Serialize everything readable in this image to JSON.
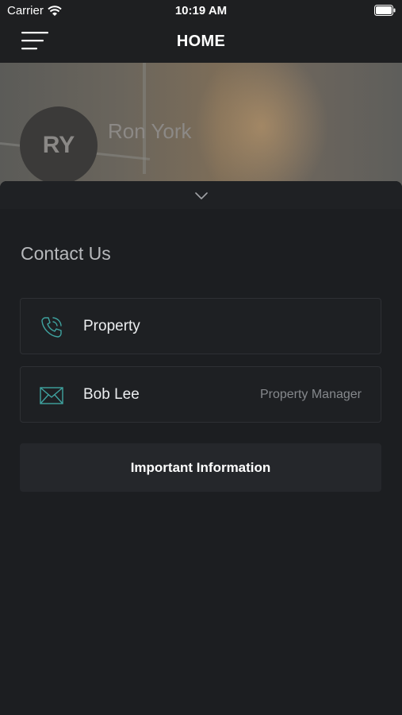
{
  "status_bar": {
    "carrier": "Carrier",
    "time": "10:19 AM"
  },
  "nav": {
    "title": "HOME",
    "menu_icon": "hamburger-menu-icon"
  },
  "profile": {
    "initials": "RY",
    "name": "Ron York"
  },
  "contact": {
    "title": "Contact Us",
    "items": [
      {
        "label": "Property",
        "subtitle": "",
        "icon": "phone-icon"
      },
      {
        "label": "Bob Lee",
        "subtitle": "Property Manager",
        "icon": "envelope-icon"
      }
    ]
  },
  "important_button": "Important Information",
  "colors": {
    "background": "#1c1e21",
    "accent": "#3fa3a0",
    "card": "#1e2023",
    "button": "#25272b"
  }
}
